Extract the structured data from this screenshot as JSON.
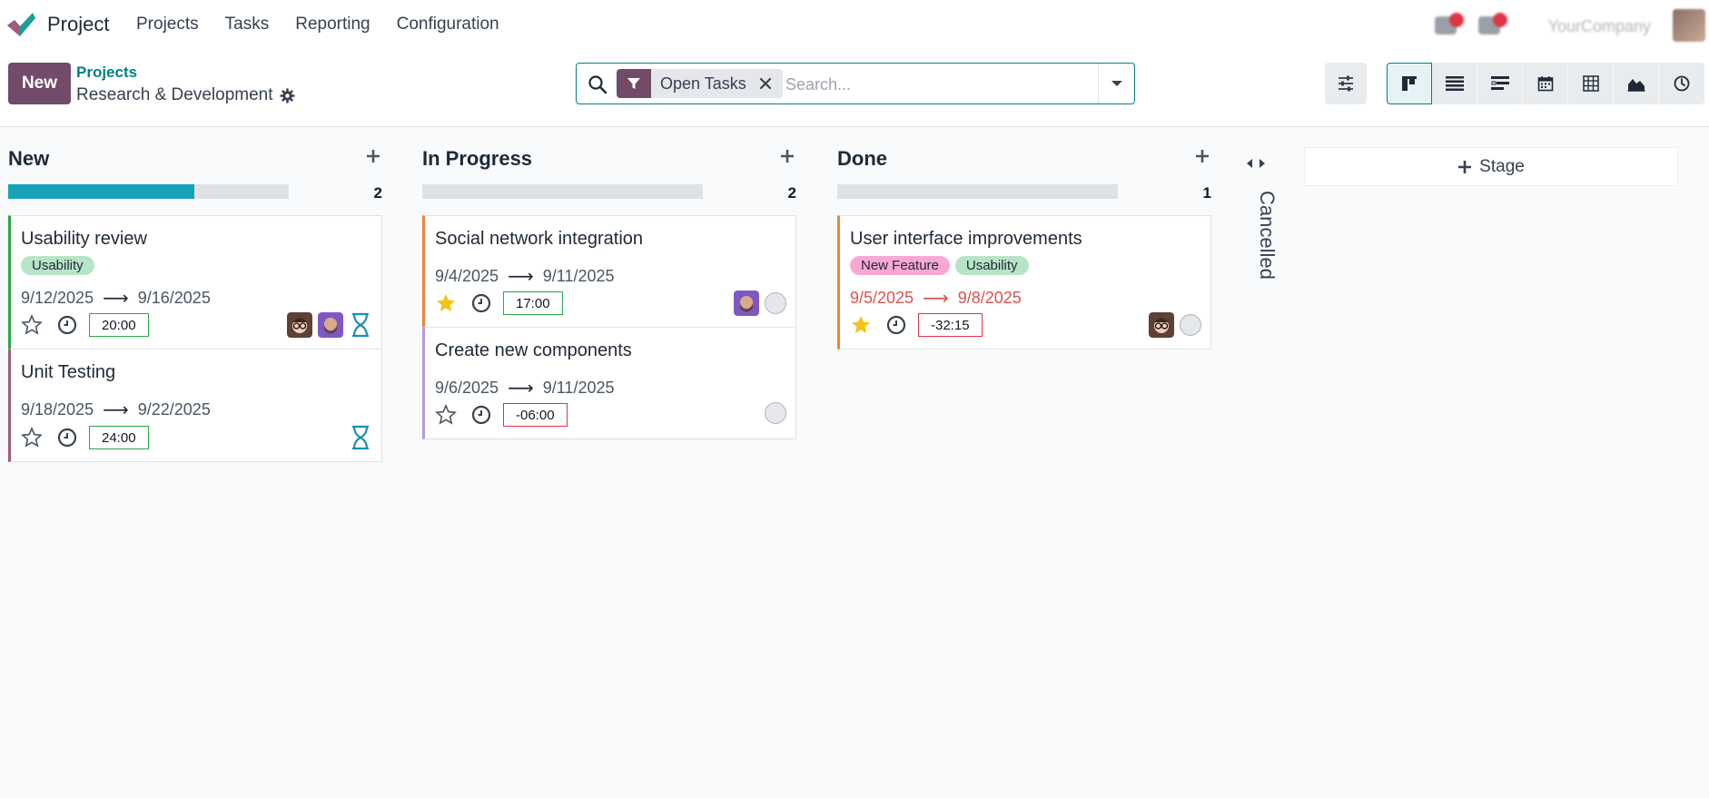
{
  "app": {
    "name": "Project",
    "company": "YourCompany"
  },
  "menu": [
    "Projects",
    "Tasks",
    "Reporting",
    "Configuration"
  ],
  "control": {
    "new_label": "New",
    "breadcrumb_parent": "Projects",
    "breadcrumb_current": "Research & Development"
  },
  "search": {
    "facet_label": "Open Tasks",
    "placeholder": "Search..."
  },
  "views": [
    "kanban",
    "list",
    "gantt",
    "calendar",
    "pivot",
    "graph",
    "activity"
  ],
  "columns": [
    {
      "title": "New",
      "count": "2",
      "progress_fraction": 0.665,
      "cards": [
        {
          "title": "Usability review",
          "tags": [
            {
              "label": "Usability",
              "color": "#b7e4c7"
            }
          ],
          "start": "9/12/2025",
          "end": "9/16/2025",
          "overdue": false,
          "starred": false,
          "time": "20:00",
          "time_ok": true,
          "accent": "#28a745",
          "avatars": [
            "avatar-glasses",
            "avatar-beard"
          ],
          "status": "hourglass"
        },
        {
          "title": "Unit Testing",
          "tags": [],
          "start": "9/18/2025",
          "end": "9/22/2025",
          "overdue": false,
          "starred": false,
          "time": "24:00",
          "time_ok": true,
          "accent": "#a2597b",
          "avatars": [],
          "status": "hourglass"
        }
      ]
    },
    {
      "title": "In Progress",
      "count": "2",
      "progress_fraction": 0,
      "cards": [
        {
          "title": "Social network integration",
          "tags": [],
          "start": "9/4/2025",
          "end": "9/11/2025",
          "overdue": false,
          "starred": true,
          "time": "17:00",
          "time_ok": true,
          "accent": "#f0833a",
          "avatars": [
            "avatar-beard"
          ],
          "status": "circle"
        },
        {
          "title": "Create new components",
          "tags": [],
          "start": "9/6/2025",
          "end": "9/11/2025",
          "overdue": false,
          "starred": false,
          "time": "-06:00",
          "time_ok": false,
          "accent": "#b39ddb",
          "avatars": [],
          "status": "circle"
        }
      ]
    },
    {
      "title": "Done",
      "count": "1",
      "progress_fraction": 0,
      "cards": [
        {
          "title": "User interface improvements",
          "tags": [
            {
              "label": "New Feature",
              "color": "#f7a8d2"
            },
            {
              "label": "Usability",
              "color": "#b7e4c7"
            }
          ],
          "start": "9/5/2025",
          "end": "9/8/2025",
          "overdue": true,
          "starred": true,
          "time": "-32:15",
          "time_ok": false,
          "accent": "#f0833a",
          "avatars": [
            "avatar-glasses"
          ],
          "status": "circle"
        }
      ]
    }
  ],
  "folded_column": {
    "label": "Cancelled"
  },
  "add_stage_label": "Stage",
  "colors": {
    "brand": "#714b67",
    "teal": "#017e84",
    "progress": "#17a2b8",
    "danger": "#dc3545",
    "success": "#28a745"
  }
}
